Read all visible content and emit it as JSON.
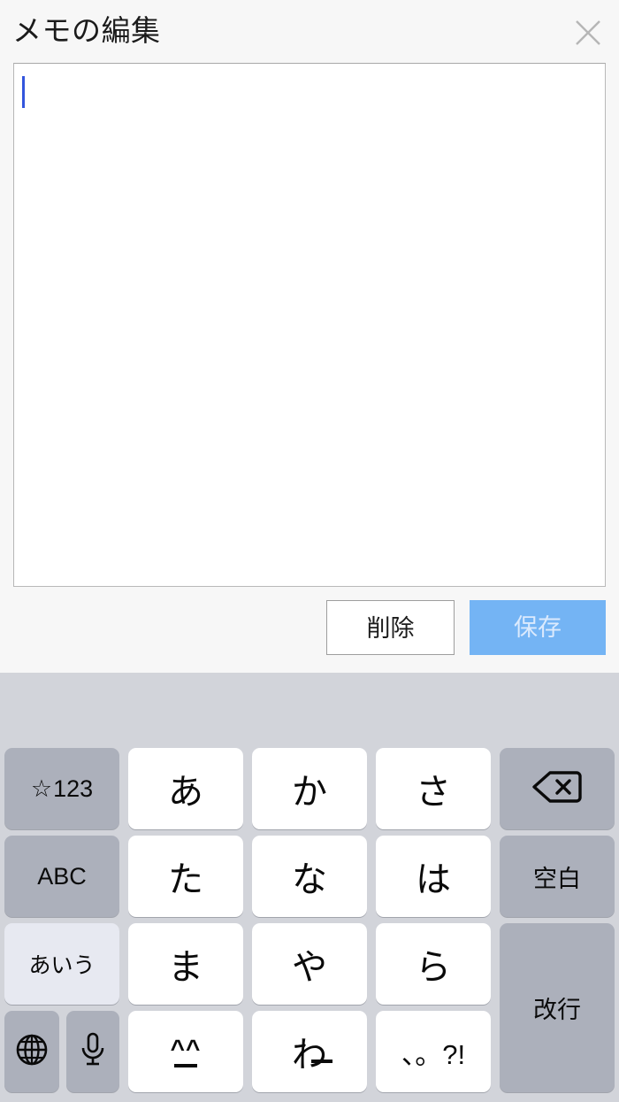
{
  "dialog": {
    "title": "メモの編集",
    "close_icon": "close-icon",
    "textarea": {
      "value": "",
      "placeholder": ""
    },
    "buttons": {
      "delete_label": "削除",
      "save_label": "保存"
    },
    "colors": {
      "save_background": "#74b4f4",
      "save_text": "#dbeafd",
      "caret": "#3355dd",
      "dialog_background": "#f7f7f7"
    }
  },
  "keyboard": {
    "colors": {
      "background": "#d2d4da",
      "key_white": "#ffffff",
      "key_gray": "#acb0bb",
      "key_active": "#e7e9f1"
    },
    "suggestions": [],
    "rows": [
      {
        "keys": [
          {
            "name": "key-symbols",
            "label": "☆123",
            "type": "function",
            "style": "gray"
          },
          {
            "name": "key-a",
            "label": "あ",
            "type": "kana",
            "style": "white"
          },
          {
            "name": "key-ka",
            "label": "か",
            "type": "kana",
            "style": "white"
          },
          {
            "name": "key-sa",
            "label": "さ",
            "type": "kana",
            "style": "white"
          },
          {
            "name": "key-backspace",
            "label": "",
            "icon": "backspace-icon",
            "type": "function",
            "style": "gray"
          }
        ]
      },
      {
        "keys": [
          {
            "name": "key-abc",
            "label": "ABC",
            "type": "function",
            "style": "gray"
          },
          {
            "name": "key-ta",
            "label": "た",
            "type": "kana",
            "style": "white"
          },
          {
            "name": "key-na",
            "label": "な",
            "type": "kana",
            "style": "white"
          },
          {
            "name": "key-ha",
            "label": "は",
            "type": "kana",
            "style": "white"
          },
          {
            "name": "key-space",
            "label": "空白",
            "type": "function",
            "style": "gray"
          }
        ]
      },
      {
        "keys": [
          {
            "name": "key-aiu",
            "label": "あいう",
            "type": "function",
            "style": "light"
          },
          {
            "name": "key-ma",
            "label": "ま",
            "type": "kana",
            "style": "white"
          },
          {
            "name": "key-ya",
            "label": "や",
            "type": "kana",
            "style": "white"
          },
          {
            "name": "key-ra",
            "label": "ら",
            "type": "kana",
            "style": "white"
          },
          {
            "name": "key-return",
            "label": "改行",
            "type": "function",
            "style": "gray"
          }
        ]
      },
      {
        "keys": [
          {
            "name": "key-globe",
            "label": "",
            "icon": "globe-icon",
            "type": "function",
            "style": "gray"
          },
          {
            "name": "key-mic",
            "label": "",
            "icon": "microphone-icon",
            "type": "function",
            "style": "gray"
          },
          {
            "name": "key-emoji",
            "label": "^_^",
            "type": "kana",
            "style": "white"
          },
          {
            "name": "key-wa",
            "label": "わ",
            "type": "kana",
            "style": "white"
          },
          {
            "name": "key-punctuation",
            "label": "、。?!",
            "type": "kana",
            "style": "white"
          }
        ]
      }
    ],
    "labels": {
      "symbols": "☆123",
      "star": "☆",
      "numbers": "123",
      "abc": "ABC",
      "aiu": "あいう",
      "space": "空白",
      "return": "改行",
      "a": "あ",
      "ka": "か",
      "sa": "さ",
      "ta": "た",
      "na": "な",
      "ha": "は",
      "ma": "ま",
      "ya": "や",
      "ra": "ら",
      "wa": "わ",
      "emoji": "^^",
      "punctuation": "、。?!"
    }
  }
}
